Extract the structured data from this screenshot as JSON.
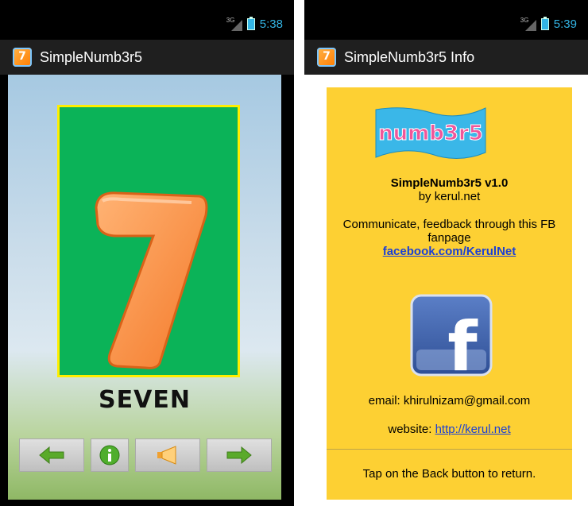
{
  "left": {
    "status_time": "5:38",
    "network_label": "3G",
    "title": "SimpleNumb3r5",
    "app_icon_glyph": "7",
    "digit": "7",
    "word": "SEVEN",
    "colors": {
      "card": "#0bb358",
      "card_border": "#ffee00",
      "digit": "#ff9a4a"
    }
  },
  "right": {
    "status_time": "5:39",
    "network_label": "3G",
    "title": "SimpleNumb3r5 Info",
    "app_icon_glyph": "7",
    "logo_text": "numb3r5",
    "version_line": "SimpleNumb3r5 v1.0",
    "by_line": "by kerul.net",
    "communicate_line1": "Communicate, feedback through this FB",
    "communicate_line2": "fanpage",
    "fb_link": "facebook.com/KerulNet",
    "fb_letter": "f",
    "email_line": "email: khirulnizam@gmail.com",
    "website_label": "website: ",
    "website_link": "http://kerul.net",
    "back_hint": "Tap on the Back button to return.",
    "colors": {
      "panel": "#fdd033",
      "link": "#1a3fd6"
    }
  },
  "icons": [
    "back-arrow-icon",
    "info-icon",
    "megaphone-icon",
    "forward-arrow-icon",
    "battery-icon",
    "signal-icon",
    "facebook-icon"
  ]
}
